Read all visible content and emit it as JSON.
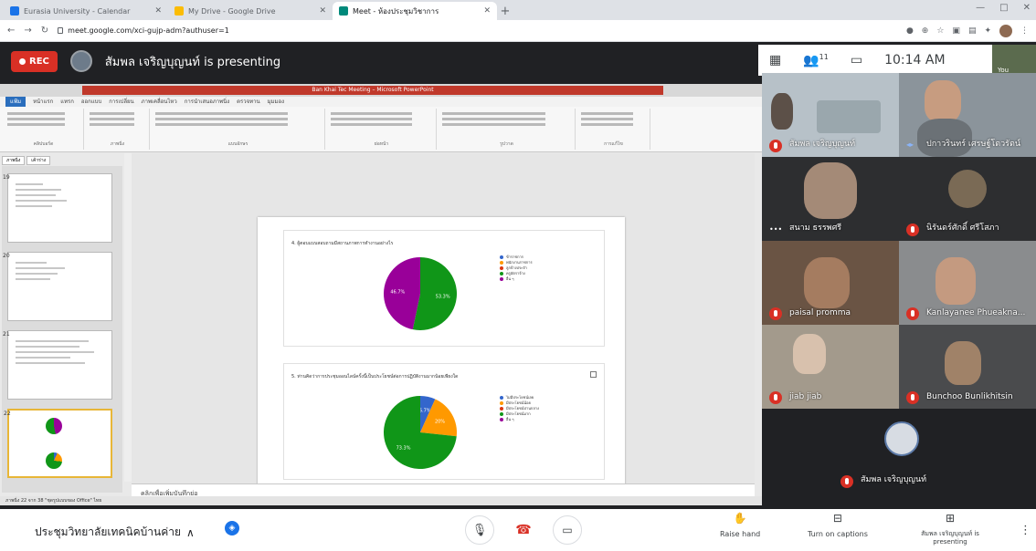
{
  "browser": {
    "tabs": [
      {
        "title": "Eurasia University - Calendar",
        "color": "#1a73e8"
      },
      {
        "title": "My Drive - Google Drive",
        "color": "#fbbc04"
      },
      {
        "title": "Meet - ห้องประชุมวิชาการ",
        "color": "#00897b"
      }
    ],
    "url": "meet.google.com/xci-gujp-adm?authuser=1"
  },
  "meet": {
    "rec_label": "REC",
    "presenter_label": "สัมพล เจริญบุญนท์ is presenting",
    "participant_count": "11",
    "clock": "10:14 AM",
    "self_label": "You",
    "meeting_name": "ประชุมวิทยาลัยเทคนิคบ้านค่าย",
    "raise_hand": "Raise hand",
    "captions": "Turn on captions",
    "present_now": "สัมพล เจริญบุญนท์ is presenting"
  },
  "powerpoint": {
    "title": "Ban Khai Tec Meeting – Microsoft PowerPoint",
    "tabs": [
      "แฟ้ม",
      "หน้าแรก",
      "แทรก",
      "ออกแบบ",
      "การเปลี่ยน",
      "ภาพเคลื่อนไหว",
      "การนำเสนอภาพนิ่ง",
      "ตรวจทาน",
      "มุมมอง"
    ],
    "ribbon_groups": [
      "คลิปบอร์ด",
      "ภาพนิ่ง",
      "แบบอักษร",
      "ย่อหน้า",
      "รูปวาด",
      "การแก้ไข"
    ],
    "panel_tabs": [
      "ภาพนิ่ง",
      "เค้าร่าง"
    ],
    "slide_numbers": [
      "19",
      "20",
      "21",
      "22"
    ],
    "notes_placeholder": "คลิกเพื่อเพิ่มบันทึกย่อ",
    "status": "ภาพนิ่ง 22 จาก 38   \"ชุดรูปแบบของ Office\"   ไทย"
  },
  "chart_data": [
    {
      "type": "pie",
      "title": "4. ผู้ตอบแบบสอบถามมีสถานภาพการทำงานอย่างไร",
      "labels": [
        "ข้าราชการ",
        "พนักงานราชการ",
        "ลูกจ้างประจำ",
        "ครูอัตราจ้าง",
        "อื่น ๆ"
      ],
      "values": [
        0,
        0,
        0,
        53.3,
        46.7
      ],
      "value_labels": [
        "",
        "",
        "",
        "53.3%",
        "46.7%"
      ],
      "colors": [
        "#3366cc",
        "#ff9900",
        "#dc3912",
        "#109618",
        "#990099"
      ]
    },
    {
      "type": "pie",
      "title": "5. ท่านคิดว่าการประชุมออนไลน์ครั้งนี้เป็นประโยชน์ต่อการปฏิบัติงานมากน้อยเพียงใด",
      "labels": [
        "ไม่มีประโยชน์เลย",
        "มีประโยชน์น้อย",
        "มีประโยชน์ปานกลาง",
        "มีประโยชน์มาก",
        "อื่น ๆ"
      ],
      "values": [
        6.7,
        20,
        0,
        73.3,
        0
      ],
      "value_labels": [
        "6.7%",
        "20%",
        "",
        "73.3%",
        ""
      ],
      "colors": [
        "#3366cc",
        "#ff9900",
        "#dc3912",
        "#109618",
        "#990099"
      ]
    }
  ],
  "participants": [
    {
      "name": "สัมพล เจริญบุญนท์",
      "muted": true
    },
    {
      "name": "ปกาวรินทร์ เศรษฐ์โตวรัตน์",
      "muted": false
    },
    {
      "name": "สนาม ธรรพศรี",
      "muted": false
    },
    {
      "name": "นิรันดร์ศักดิ์ ศรีโสภา",
      "muted": true
    },
    {
      "name": "paisal promma",
      "muted": true
    },
    {
      "name": "Kanlayanee Phueakna...",
      "muted": true
    },
    {
      "name": "jiab jiab",
      "muted": true
    },
    {
      "name": "Bunchoo Bunlikhitsin",
      "muted": true
    },
    {
      "name": "สัมพล เจริญบุญนท์",
      "muted": true
    }
  ]
}
